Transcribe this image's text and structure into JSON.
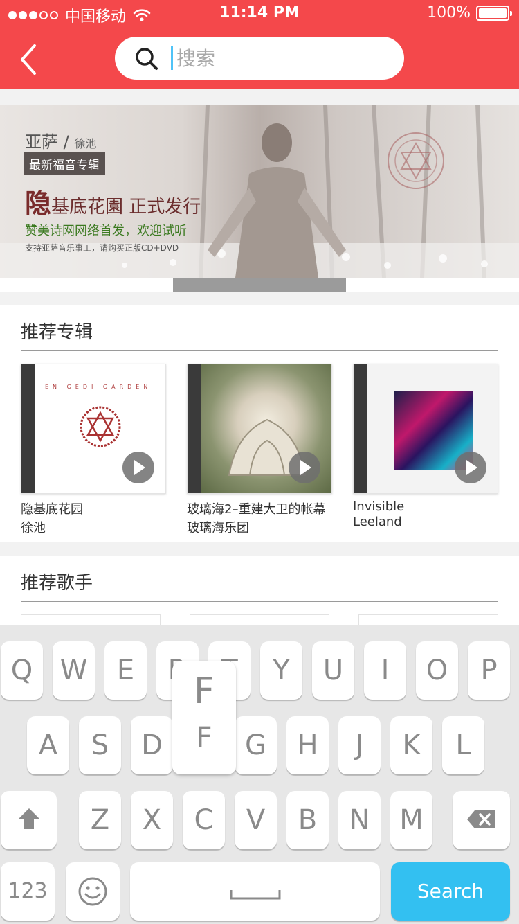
{
  "status": {
    "carrier": "中国移动",
    "time": "11:14 PM",
    "battery": "100%"
  },
  "search": {
    "placeholder": "搜索"
  },
  "banner": {
    "artist": "亚萨",
    "slash": "/",
    "producer": "徐池",
    "tag": "最新福音专辑",
    "title_main": "隐",
    "title_rest": "基底花園 正式发行",
    "subtitle": "赞美诗网网络首发，欢迎试听",
    "note": "支持亚萨音乐事工，请购买正版CD+DVD"
  },
  "albums_section": {
    "title": "推荐专辑",
    "items": [
      {
        "name": "隐基底花园",
        "artist": "徐池",
        "cover_text": "EN GEDI GARDEN"
      },
      {
        "name": "玻璃海2–重建大卫的帐幕",
        "artist": "玻璃海乐团",
        "cover_text": ""
      },
      {
        "name": "Invisible",
        "artist": "Leeland",
        "cover_text": ""
      }
    ]
  },
  "artists_section": {
    "title": "推荐歌手"
  },
  "keyboard": {
    "row1": [
      "Q",
      "W",
      "E",
      "R",
      "T",
      "Y",
      "U",
      "I",
      "O",
      "P"
    ],
    "row2": [
      "A",
      "S",
      "D",
      "F",
      "G",
      "H",
      "J",
      "K",
      "L"
    ],
    "row3": [
      "Z",
      "X",
      "C",
      "V",
      "B",
      "N",
      "M"
    ],
    "numbers_key": "123",
    "search_key": "Search",
    "popup_letter": "F"
  },
  "colors": {
    "header": "#f4484b",
    "search_key": "#33c0f1"
  }
}
